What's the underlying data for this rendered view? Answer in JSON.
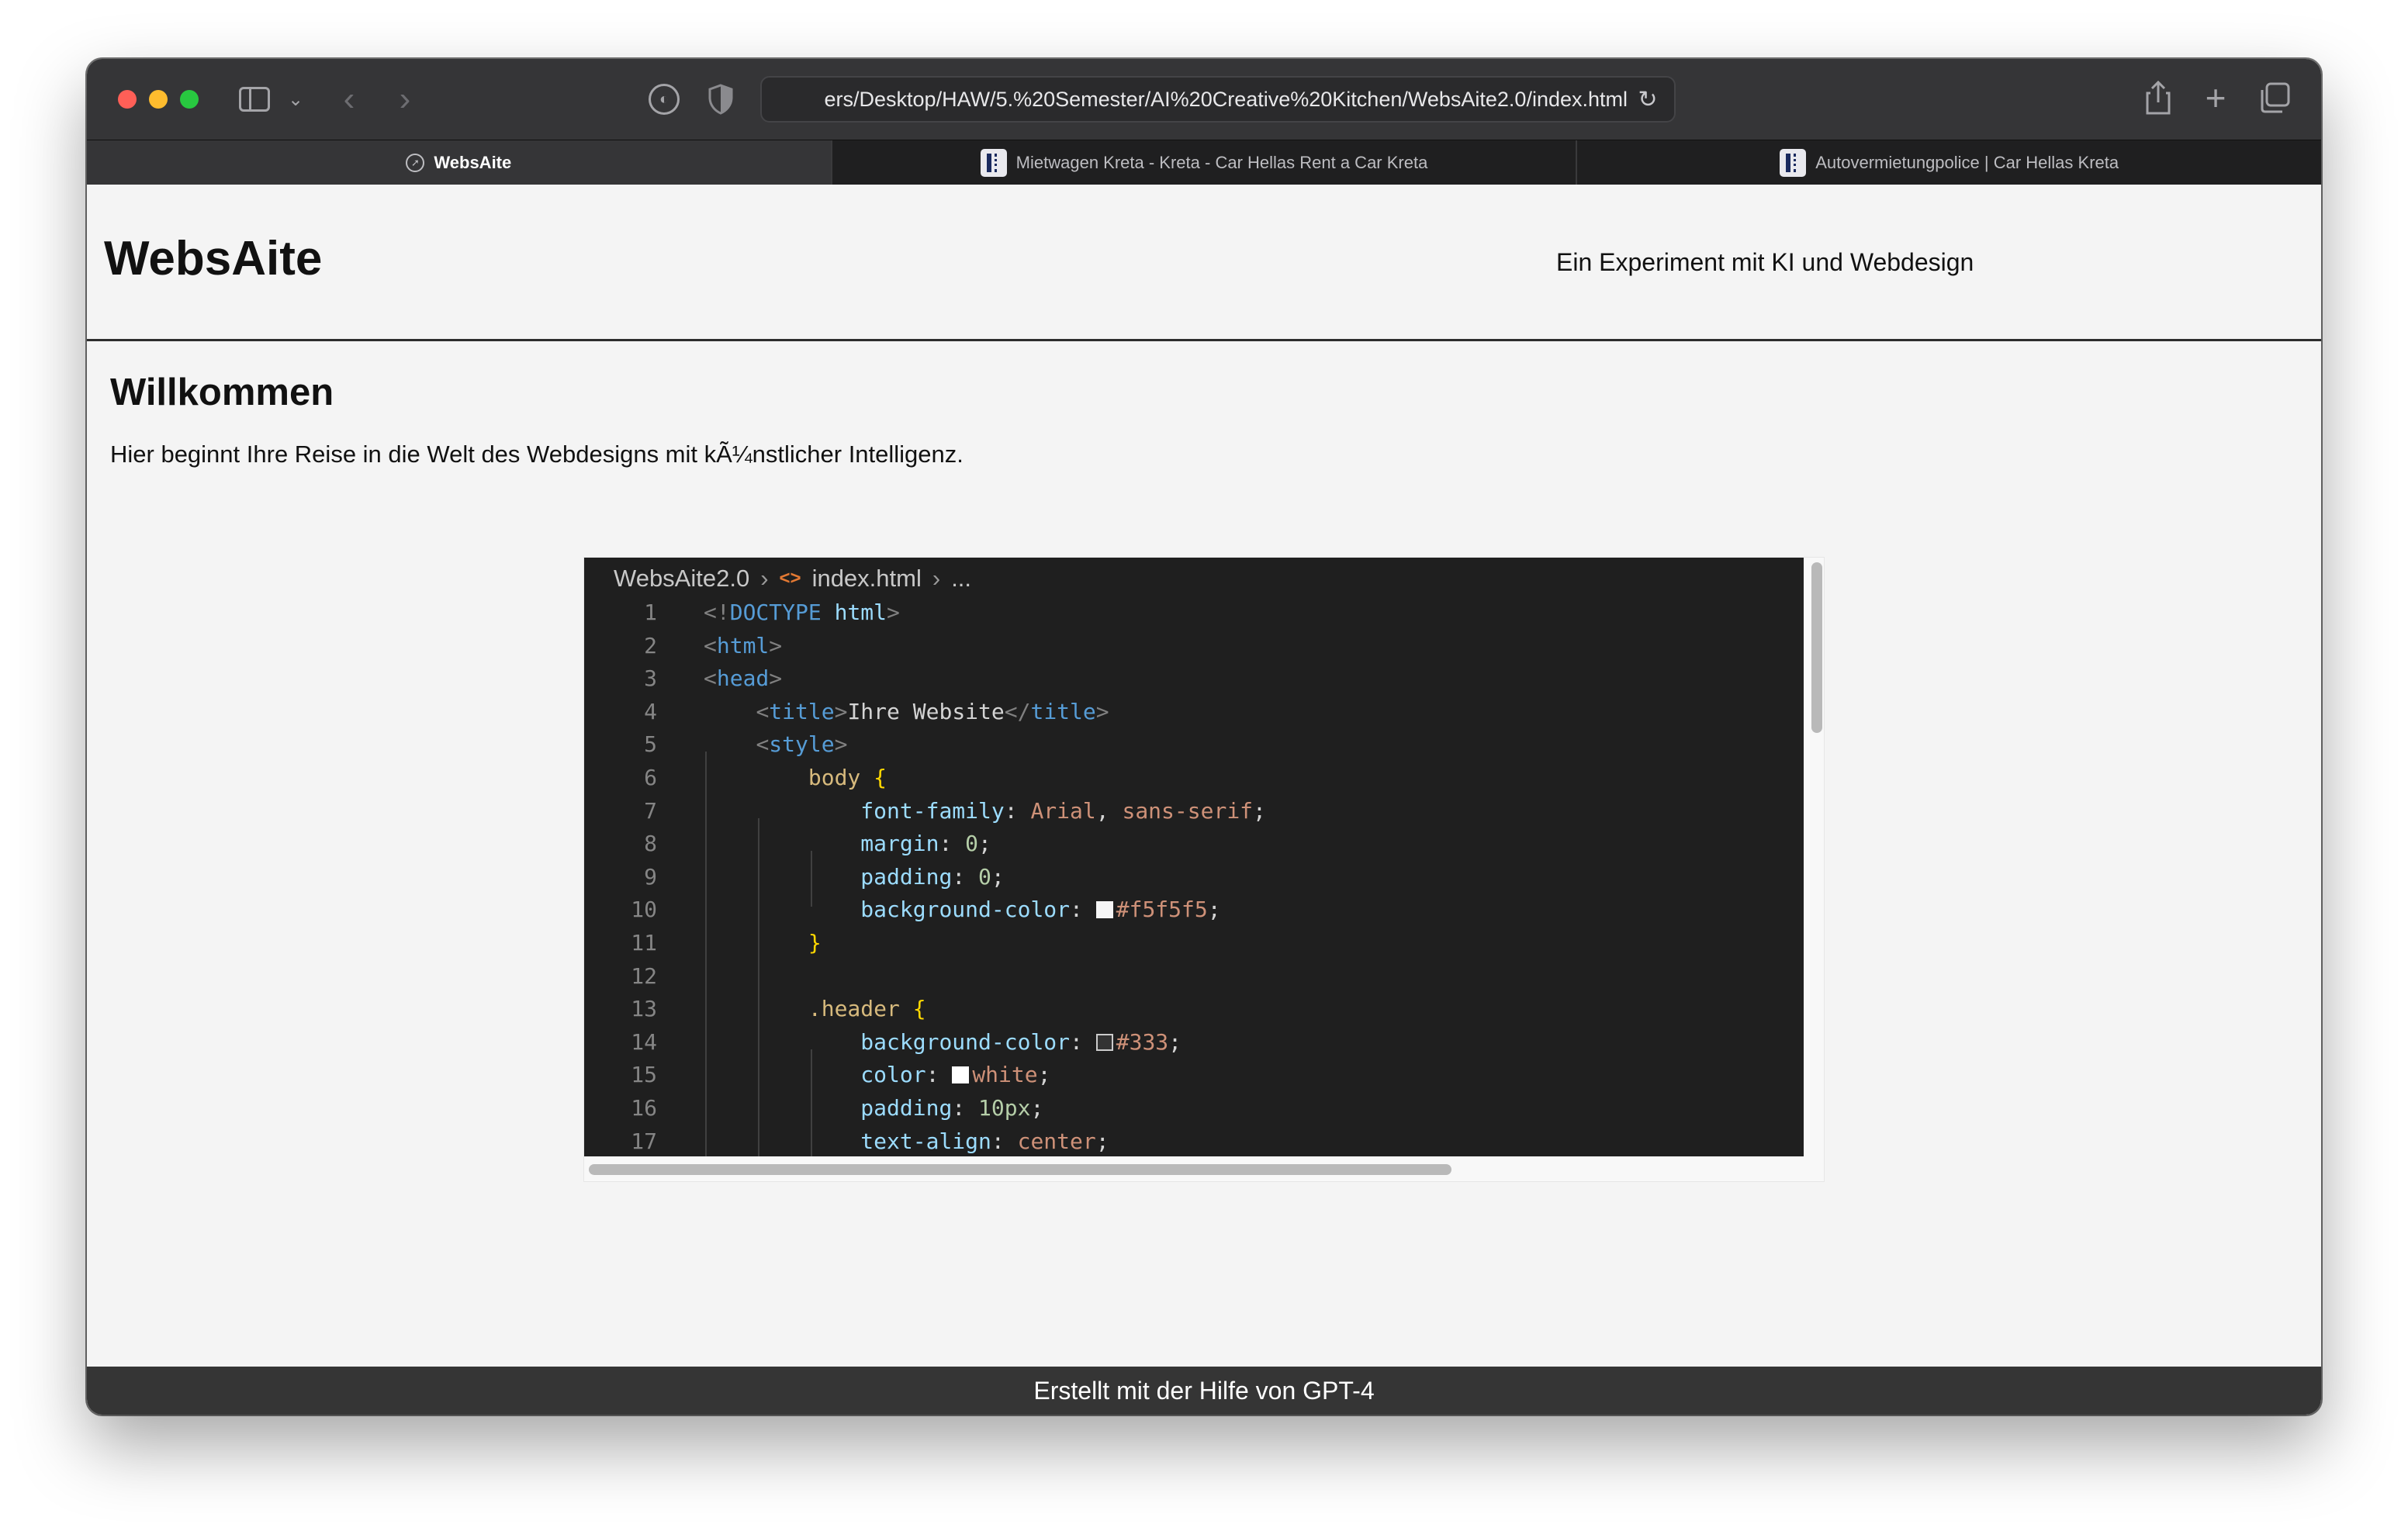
{
  "browser": {
    "url": "ers/Desktop/HAW/5.%20Semester/AI%20Creative%20Kitchen/WebsAite2.0/index.html",
    "tabs": [
      {
        "label": "WebsAite",
        "active": true,
        "icon": "compass-icon"
      },
      {
        "label": "Mietwagen Kreta - Kreta - Car Hellas Rent a Car Kreta",
        "active": false,
        "icon": "car-hellas-icon"
      },
      {
        "label": "Autovermietungpolice | Car Hellas Kreta",
        "active": false,
        "icon": "car-hellas-icon"
      }
    ]
  },
  "page": {
    "title": "WebsAite",
    "tagline": "Ein Experiment mit KI und Webdesign",
    "welcome_heading": "Willkommen",
    "welcome_text": "Hier beginnt Ihre Reise in die Welt des Webdesigns mit kÃ¼nstlicher Intelligenz.",
    "footer": "Erstellt mit der Hilfe von GPT-4"
  },
  "code": {
    "breadcrumb": {
      "folder": "WebsAite2.0",
      "file": "index.html",
      "more": "..."
    },
    "line_numbers": [
      "1",
      "2",
      "3",
      "4",
      "5",
      "6",
      "7",
      "8",
      "9",
      "10",
      "11",
      "12",
      "13",
      "14",
      "15",
      "16",
      "17"
    ],
    "swatches": {
      "f5": "#f5f5f5",
      "c333": "#333333",
      "white": "#ffffff"
    }
  }
}
